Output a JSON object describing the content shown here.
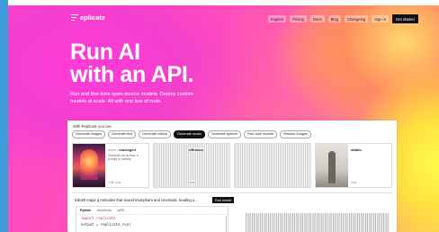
{
  "brand": {
    "logo_text": "eplicate"
  },
  "nav": {
    "items": [
      "Explore",
      "Pricing",
      "Docs",
      "Blog",
      "Changelog",
      "Sign in"
    ],
    "cta": "Get started"
  },
  "hero": {
    "headline_line1": "Run AI",
    "headline_line2": "with an API.",
    "sub_line1": "Run and fine-tune open-source models. Deploy custom",
    "sub_line2": "models at scale. All with one line of code."
  },
  "demo": {
    "label": "With Replicate you can",
    "tabs": [
      "Generate images",
      "Generate text",
      "Generate videos",
      "Generate music",
      "Generate speech",
      "Fine-tune models",
      "Restore images"
    ],
    "active_tab": "Generate music",
    "cards": [
      {
        "owner": "meta /",
        "name": "musicgen",
        "desc": "Generate music from a prompt or melody",
        "meta": "1.3M runs"
      },
      {
        "owner": "",
        "name": "riffusion",
        "desc": "",
        "meta": "runs"
      },
      {
        "owner": "",
        "name": "",
        "desc": "",
        "meta": ""
      },
      {
        "owner": "",
        "name": "stable-",
        "desc": "",
        "meta": "runs"
      }
    ],
    "prompt": "Edo25 major g melodies that sound triumphant and cinematic, leading u...",
    "run_label": "Run model",
    "code_tabs": [
      "Python",
      "JavaScript",
      "cURL"
    ],
    "active_code_tab": "Python",
    "code_lines": [
      "import replicate",
      "output = replicate.run("
    ]
  }
}
